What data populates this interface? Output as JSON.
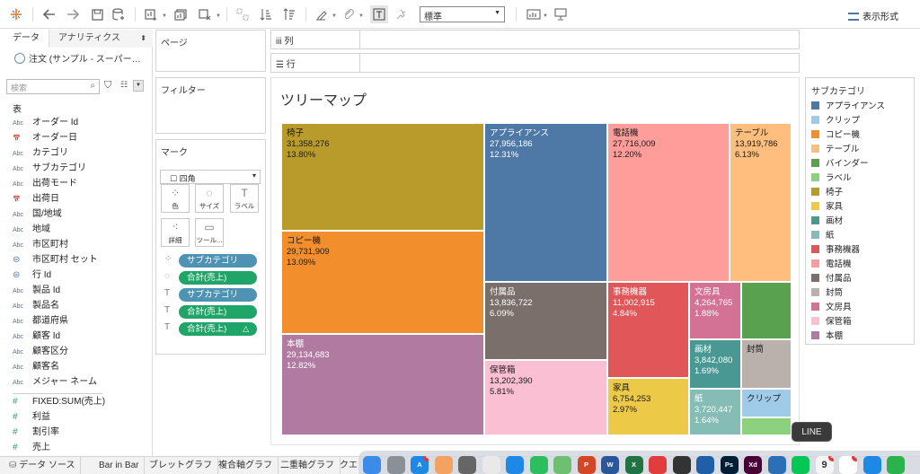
{
  "toolbar": {
    "standard_select": "標準",
    "show_me": "表示形式"
  },
  "data_pane": {
    "tab_data": "データ",
    "tab_analytics": "アナリティクス",
    "datasource": "注文 (サンプル - スーパー…",
    "search_placeholder": "検索",
    "section_header": "表",
    "fields": [
      {
        "type": "Abc",
        "name": "オーダー Id"
      },
      {
        "type": "date",
        "name": "オーダー日"
      },
      {
        "type": "Abc",
        "name": "カテゴリ"
      },
      {
        "type": "Abc",
        "name": "サブカテゴリ"
      },
      {
        "type": "Abc",
        "name": "出荷モード"
      },
      {
        "type": "date",
        "name": "出荷日"
      },
      {
        "type": "Abc",
        "name": "国/地域"
      },
      {
        "type": "Abc",
        "name": "地域"
      },
      {
        "type": "Abc",
        "name": "市区町村"
      },
      {
        "type": "geo",
        "name": "市区町村 セット"
      },
      {
        "type": "geo",
        "name": "行 Id"
      },
      {
        "type": "Abc",
        "name": "製品 Id"
      },
      {
        "type": "Abc",
        "name": "製品名"
      },
      {
        "type": "Abc",
        "name": "都道府県"
      },
      {
        "type": "Abc",
        "name": "顧客 Id"
      },
      {
        "type": "Abc",
        "name": "顧客区分"
      },
      {
        "type": "Abc",
        "name": "顧客名"
      },
      {
        "type": "Abc",
        "name": "メジャー ネーム"
      },
      {
        "type": "#",
        "name": "FIXED:SUM(売上)"
      },
      {
        "type": "#",
        "name": "利益"
      },
      {
        "type": "#",
        "name": "割引率"
      },
      {
        "type": "#",
        "name": "売上"
      }
    ]
  },
  "pages": "ページ",
  "filters": "フィルター",
  "marks": {
    "title": "マーク",
    "type": "四角",
    "buttons": {
      "color": "色",
      "size": "サイズ",
      "label": "ラベル",
      "detail": "詳細",
      "tooltip": "ツール..."
    },
    "pills": [
      {
        "label": "サブカテゴリ",
        "style": "b"
      },
      {
        "label": "合計(売上)",
        "style": "gr"
      },
      {
        "label": "サブカテゴリ",
        "style": "b"
      },
      {
        "label": "合計(売上)",
        "style": "gr"
      },
      {
        "label": "合計(売上)",
        "style": "gr",
        "delta": "△"
      }
    ]
  },
  "shelves": {
    "columns": "列",
    "rows": "行"
  },
  "chart_data": {
    "type": "treemap",
    "title": "ツリーマップ",
    "legend_title": "サブカテゴリ",
    "items": [
      {
        "name": "椅子",
        "value": "31,358,276",
        "pct": "13.80%",
        "color": "#b89b2b"
      },
      {
        "name": "コピー機",
        "value": "29,731,909",
        "pct": "13.09%",
        "color": "#f28e2b"
      },
      {
        "name": "本棚",
        "value": "29,134,683",
        "pct": "12.82%",
        "color": "#b07aa1"
      },
      {
        "name": "アプライアンス",
        "value": "27,956,186",
        "pct": "12.31%",
        "color": "#4e79a7"
      },
      {
        "name": "電話機",
        "value": "27,716,009",
        "pct": "12.20%",
        "color": "#ff9d9a"
      },
      {
        "name": "テーブル",
        "value": "13,919,786",
        "pct": "6.13%",
        "color": "#ffbe7d"
      },
      {
        "name": "付属品",
        "value": "13,836,722",
        "pct": "6.09%",
        "color": "#7a6f6b"
      },
      {
        "name": "保管箱",
        "value": "13,202,390",
        "pct": "5.81%",
        "color": "#fabfd2"
      },
      {
        "name": "事務機器",
        "value": "11,002,915",
        "pct": "4.84%",
        "color": "#e15759"
      },
      {
        "name": "家具",
        "value": "6,754,253",
        "pct": "2.97%",
        "color": "#edc948"
      },
      {
        "name": "文房具",
        "value": "4,264,765",
        "pct": "1.88%",
        "color": "#d37295"
      },
      {
        "name": "画材",
        "value": "3,842,080",
        "pct": "1.69%",
        "color": "#499894"
      },
      {
        "name": "紙",
        "value": "3,720,447",
        "pct": "1.64%",
        "color": "#86bcb6"
      },
      {
        "name": "バインダー",
        "value": "",
        "pct": "",
        "color": "#59a14f"
      },
      {
        "name": "封筒",
        "value": "",
        "pct": "",
        "color": "#bab0ac"
      },
      {
        "name": "クリップ",
        "value": "",
        "pct": "",
        "color": "#a0cbe8"
      },
      {
        "name": "ラベル",
        "value": "",
        "pct": "",
        "color": "#8cd17d"
      }
    ],
    "legend": [
      {
        "name": "アプライアンス",
        "color": "#4e79a7"
      },
      {
        "name": "クリップ",
        "color": "#a0cbe8"
      },
      {
        "name": "コピー機",
        "color": "#f28e2b"
      },
      {
        "name": "テーブル",
        "color": "#ffbe7d"
      },
      {
        "name": "バインダー",
        "color": "#59a14f"
      },
      {
        "name": "ラベル",
        "color": "#8cd17d"
      },
      {
        "name": "椅子",
        "color": "#b89b2b"
      },
      {
        "name": "家具",
        "color": "#edc948"
      },
      {
        "name": "画材",
        "color": "#499894"
      },
      {
        "name": "紙",
        "color": "#86bcb6"
      },
      {
        "name": "事務機器",
        "color": "#e15759"
      },
      {
        "name": "電話機",
        "color": "#ff9d9a"
      },
      {
        "name": "付属品",
        "color": "#7a6f6b"
      },
      {
        "name": "封筒",
        "color": "#bab0ac"
      },
      {
        "name": "文房具",
        "color": "#d37295"
      },
      {
        "name": "保管箱",
        "color": "#fabfd2"
      },
      {
        "name": "本棚",
        "color": "#b07aa1"
      }
    ]
  },
  "bottom_tabs": [
    "データ ソース",
    "Bar in Bar",
    "ブレットグラフ",
    "複合軸グラフ",
    "二重軸グラフ",
    "クエ"
  ],
  "dock": {
    "tooltip": "LINE",
    "calendar_day": "9",
    "apps": [
      {
        "name": "finder-icon",
        "label": "",
        "color": "#3d8be8"
      },
      {
        "name": "launchpad-icon",
        "label": "",
        "color": "#8a8f98"
      },
      {
        "name": "app-store-icon",
        "label": "A",
        "color": "#1e88e5",
        "badge": "5"
      },
      {
        "name": "photos-icon",
        "label": "",
        "color": "#f4a261"
      },
      {
        "name": "chrome-icon",
        "label": "",
        "color": "#666"
      },
      {
        "name": "textedit-icon",
        "label": "",
        "color": "#e9e9e9"
      },
      {
        "name": "safari-icon",
        "label": "",
        "color": "#1e88e5"
      },
      {
        "name": "evernote-icon",
        "label": "",
        "color": "#2dbe60"
      },
      {
        "name": "maps-icon",
        "label": "",
        "color": "#6cc070"
      },
      {
        "name": "powerpoint-icon",
        "label": "P",
        "color": "#d24726"
      },
      {
        "name": "word-icon",
        "label": "W",
        "color": "#2b579a"
      },
      {
        "name": "excel-icon",
        "label": "X",
        "color": "#217346"
      },
      {
        "name": "player-icon",
        "label": "",
        "color": "#e23c3c"
      },
      {
        "name": "terminal-icon",
        "label": "",
        "color": "#333"
      },
      {
        "name": "tableau-icon",
        "label": "",
        "color": "#1f5fa8"
      },
      {
        "name": "photoshop-icon",
        "label": "Ps",
        "color": "#001e36"
      },
      {
        "name": "xd-icon",
        "label": "Xd",
        "color": "#470137"
      },
      {
        "name": "search-app-icon",
        "label": "",
        "color": "#2c6fb7"
      },
      {
        "name": "line-icon",
        "label": "",
        "color": "#06c755"
      },
      {
        "name": "calendar-icon",
        "label": "",
        "color": "#f5f5f5",
        "badge": "1"
      },
      {
        "name": "slack-icon",
        "label": "",
        "color": "#ffffff",
        "badge": "1"
      },
      {
        "name": "mail-icon",
        "label": "",
        "color": "#1e88e5"
      },
      {
        "name": "messages-icon",
        "label": "",
        "color": "#2bb24c"
      }
    ]
  }
}
